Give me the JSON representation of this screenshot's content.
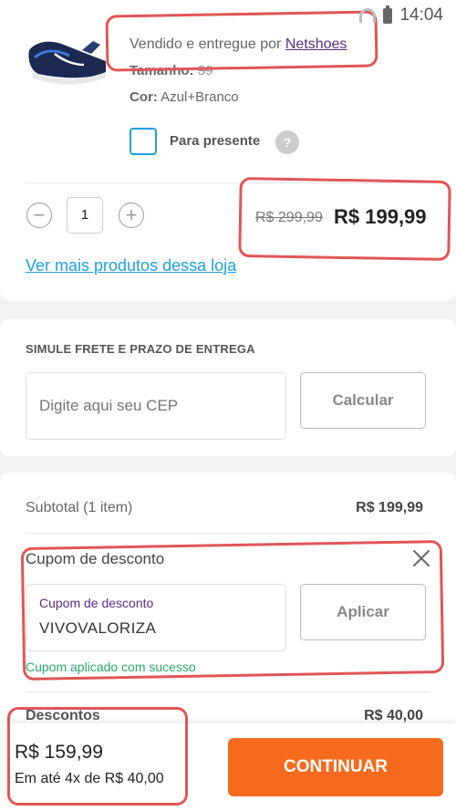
{
  "status_bar": {
    "time": "14:04"
  },
  "product": {
    "seller_prefix": "Vendido e entregue por",
    "seller_name": "Netshoes",
    "size_label": "Tamanho:",
    "size_value": "39",
    "color_label": "Cor:",
    "color_value": "Azul+Branco",
    "gift_label": "Para presente",
    "gift_help": "?",
    "quantity": "1",
    "old_price": "R$ 299,99",
    "new_price": "R$ 199,99",
    "more_products_link": "Ver mais produtos dessa loja"
  },
  "shipping": {
    "title": "SIMULE FRETE E PRAZO DE ENTREGA",
    "cep_placeholder": "Digite aqui seu CEP",
    "calculate_label": "Calcular"
  },
  "summary": {
    "subtotal_label": "Subtotal (1 item)",
    "subtotal_value": "R$ 199,99",
    "coupon_title": "Cupom de desconto",
    "coupon_field_label": "Cupom de desconto",
    "coupon_code": "VIVOVALORIZA",
    "apply_label": "Aplicar",
    "coupon_success": "Cupom aplicado com sucesso",
    "discounts_label": "Descontos",
    "discounts_value": "R$ 40,00"
  },
  "footer": {
    "total": "R$ 159,99",
    "installments": "Em até 4x de R$ 40,00",
    "continue_label": "CONTINUAR"
  },
  "colors": {
    "accent_orange": "#f66a1d",
    "link_blue": "#1ea0e0",
    "seller_purple": "#5a2d82",
    "success_green": "#2aa866",
    "annotation_red": "#e25555"
  }
}
